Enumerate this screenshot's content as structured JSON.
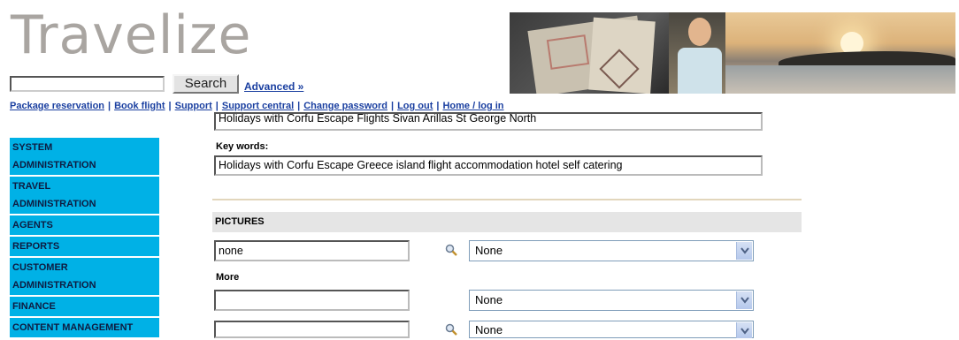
{
  "header": {
    "logo": "Travelize",
    "search_button": "Search",
    "advanced_link": "Advanced »"
  },
  "topnav": [
    "Package reservation",
    "Book flight",
    "Support",
    "Support central",
    "Change password",
    "Log out",
    "Home / log in"
  ],
  "sidebar": {
    "items": [
      "SYSTEM ADMINISTRATION",
      "TRAVEL ADMINISTRATION",
      "AGENTS",
      "REPORTS",
      "CUSTOMER ADMINISTRATION",
      "FINANCE",
      "CONTENT MANAGEMENT"
    ]
  },
  "form": {
    "description_value": "Holidays with Corfu Escape Flights Sivan Arillas St George North",
    "keywords_label": "Key words:",
    "keywords_value": "Holidays with Corfu Escape Greece island flight accommodation hotel self catering",
    "pictures_label": "PICTURES",
    "picture1_value": "none",
    "picture1_select": "None",
    "more_label": "More",
    "picture2_value": "",
    "picture2_select": "None",
    "picture3_value": "",
    "picture3_select": "None"
  }
}
